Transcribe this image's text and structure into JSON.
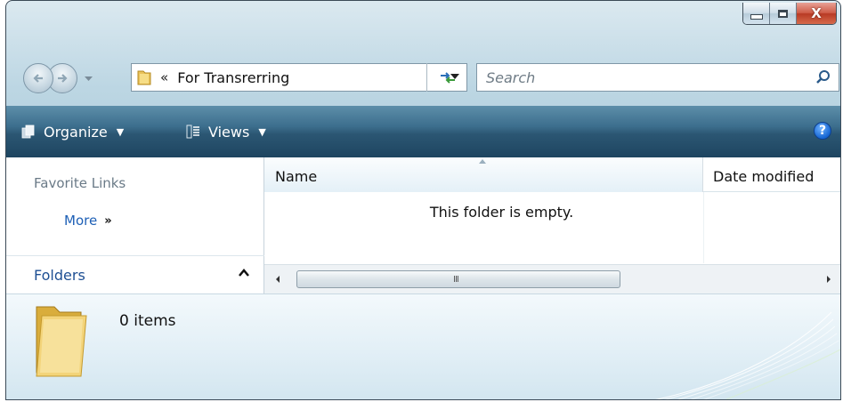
{
  "window": {
    "caption": {
      "minimize": "minimize",
      "maximize": "maximize",
      "close": "X"
    }
  },
  "navigation": {
    "address_separator": "«",
    "address_path": "For Transrerring",
    "search_placeholder": "Search"
  },
  "toolbar": {
    "organize_label": "Organize",
    "views_label": "Views",
    "help_label": "?"
  },
  "nav_pane": {
    "favorite_links_title": "Favorite Links",
    "more_label": "More",
    "more_chevron": "»",
    "folders_label": "Folders"
  },
  "file_list": {
    "columns": [
      "Name",
      "Date modified"
    ],
    "empty_message": "This folder is empty.",
    "scroll_grip": "III"
  },
  "details_pane": {
    "item_count": "0 items"
  },
  "colors": {
    "accent_link": "#1e60b6",
    "toolbar_dark": "#1e4560"
  },
  "icons": [
    "back-arrow-icon",
    "forward-arrow-icon",
    "folder-icon",
    "refresh-icon",
    "search-icon",
    "organize-icon",
    "views-icon",
    "help-icon",
    "collapse-chevron-icon",
    "sort-arrow-icon"
  ]
}
